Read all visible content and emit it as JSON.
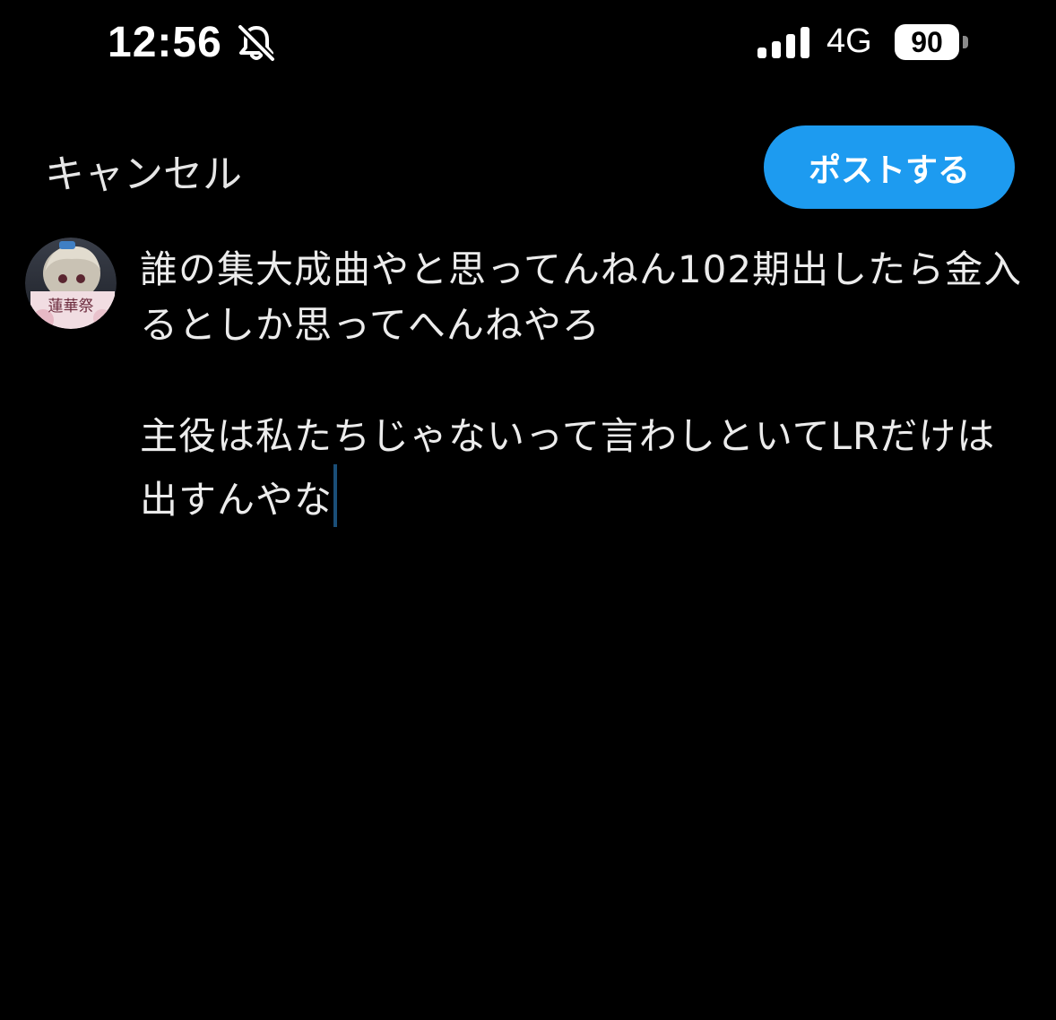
{
  "status_bar": {
    "time": "12:56",
    "silent_icon": "bell-slash-icon",
    "signal_icon": "cellular-signal-icon",
    "network": "4G",
    "battery_level": "90"
  },
  "header": {
    "cancel_label": "キャンセル",
    "post_label": "ポストする",
    "accent_color": "#1d9bf0"
  },
  "composer": {
    "avatar_icon": "user-avatar",
    "avatar_text": "蓮華祭",
    "paragraphs": [
      "誰の集大成曲やと思ってんねん102期出したら金入るとしか思ってへんねやろ",
      "主役は私たちじゃないって言わしといてLRだけは出すんやな"
    ]
  }
}
